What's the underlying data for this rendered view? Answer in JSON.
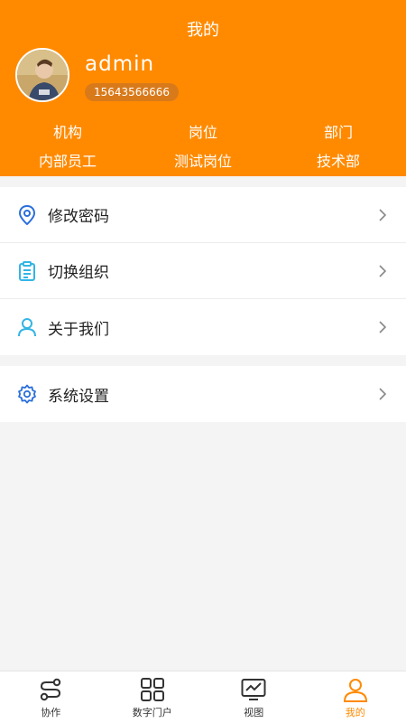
{
  "header": {
    "title": "我的",
    "username": "admin",
    "phone": "15643566666",
    "info": [
      {
        "label": "机构",
        "value": "内部员工"
      },
      {
        "label": "岗位",
        "value": "测试岗位"
      },
      {
        "label": "部门",
        "value": "技术部"
      }
    ]
  },
  "menu": {
    "group1": [
      {
        "label": "修改密码",
        "icon": "location-pin-icon"
      },
      {
        "label": "切换组织",
        "icon": "clipboard-icon"
      },
      {
        "label": "关于我们",
        "icon": "person-icon"
      }
    ],
    "group2": [
      {
        "label": "系统设置",
        "icon": "settings-gear-icon"
      }
    ]
  },
  "tabbar": {
    "tabs": [
      {
        "label": "协作",
        "icon": "collaborate-icon"
      },
      {
        "label": "数字门户",
        "icon": "grid-icon"
      },
      {
        "label": "视图",
        "icon": "chart-monitor-icon"
      },
      {
        "label": "我的",
        "icon": "user-icon",
        "active": true
      }
    ]
  },
  "colors": {
    "accent": "#ff8a00",
    "icon_blue": "#2a6fdb",
    "icon_cyan": "#33b5e5"
  }
}
